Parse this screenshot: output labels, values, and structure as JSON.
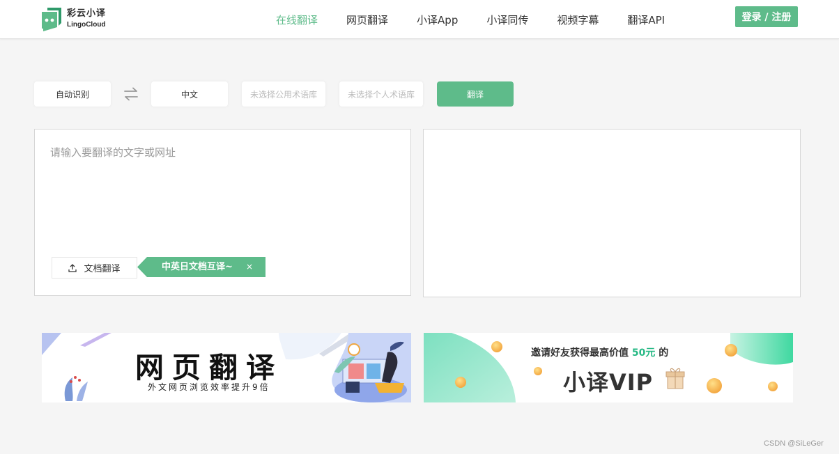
{
  "header": {
    "logo": {
      "cn": "彩云小译",
      "en": "LingoCloud"
    },
    "nav": [
      {
        "label": "在线翻译",
        "active": true
      },
      {
        "label": "网页翻译",
        "active": false
      },
      {
        "label": "小译App",
        "active": false
      },
      {
        "label": "小译同传",
        "active": false
      },
      {
        "label": "视频字幕",
        "active": false
      },
      {
        "label": "翻译API",
        "active": false
      }
    ],
    "login_label": "登录 / 注册"
  },
  "toolbar": {
    "source_lang": "自动识别",
    "swap_icon": "swap-arrows-icon",
    "target_lang": "中文",
    "public_glossary_placeholder": "未选择公用术语库",
    "personal_glossary_placeholder": "未选择个人术语库",
    "translate_label": "翻译"
  },
  "source_panel": {
    "placeholder": "请输入要翻译的文字或网址",
    "value": "",
    "doc_button_label": "文档翻译",
    "doc_button_icon": "upload-icon",
    "tip_text": "中英日文档互译~",
    "tip_close": "×"
  },
  "target_panel": {
    "value": ""
  },
  "banners": {
    "left": {
      "title": "网页翻译",
      "subtitle": "外文网页浏览效率提升9倍"
    },
    "right": {
      "line1_prefix": "邀请好友获得最高价值 ",
      "line1_highlight": "50元",
      "line1_suffix": " 的",
      "title": "小译VIP"
    }
  },
  "watermark": "CSDN @SiLeGer",
  "colors": {
    "accent": "#5ebb8a",
    "background": "#f5f5f5",
    "placeholder": "#bbbbbb"
  }
}
